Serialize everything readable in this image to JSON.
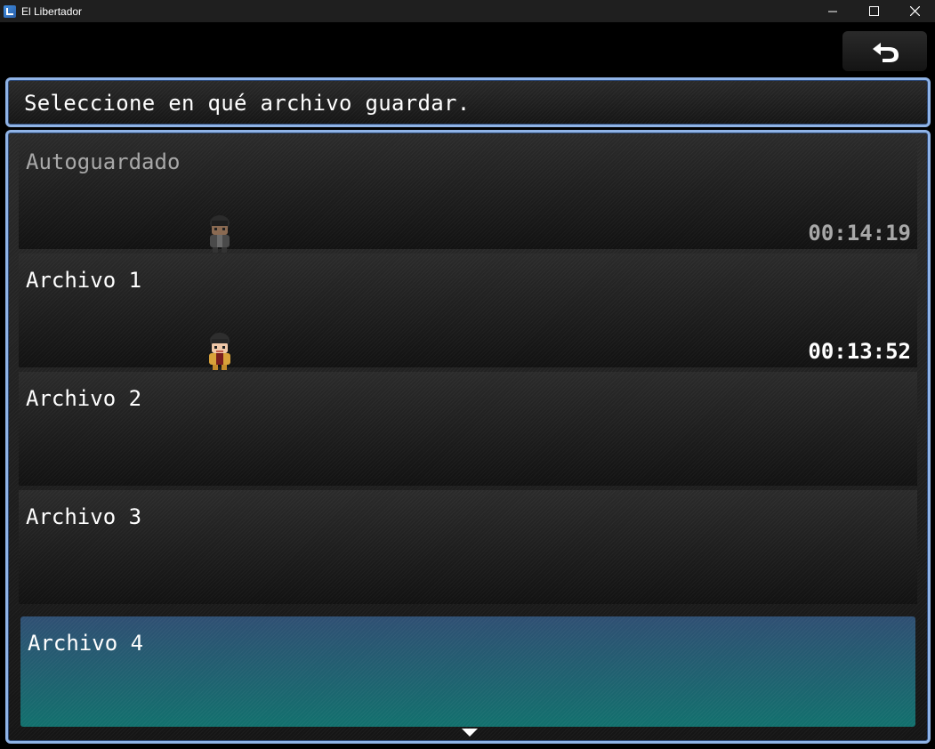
{
  "window": {
    "title": "El Libertador"
  },
  "help": {
    "text": "Seleccione en qué archivo guardar."
  },
  "slots": [
    {
      "title": "Autoguardado",
      "time": "00:14:19",
      "state": "disabled",
      "sprite": "character-dark-icon"
    },
    {
      "title": "Archivo 1",
      "time": "00:13:52",
      "state": "normal",
      "sprite": "character-gold-icon"
    },
    {
      "title": "Archivo 2",
      "time": "",
      "state": "empty"
    },
    {
      "title": "Archivo 3",
      "time": "",
      "state": "empty"
    },
    {
      "title": "Archivo 4",
      "time": "",
      "state": "selected"
    }
  ],
  "colors": {
    "window_border": "#8fb3e6",
    "selected_top": "#2f4f73",
    "selected_bottom": "#12706d",
    "disabled_text": "#a8a8a8"
  }
}
